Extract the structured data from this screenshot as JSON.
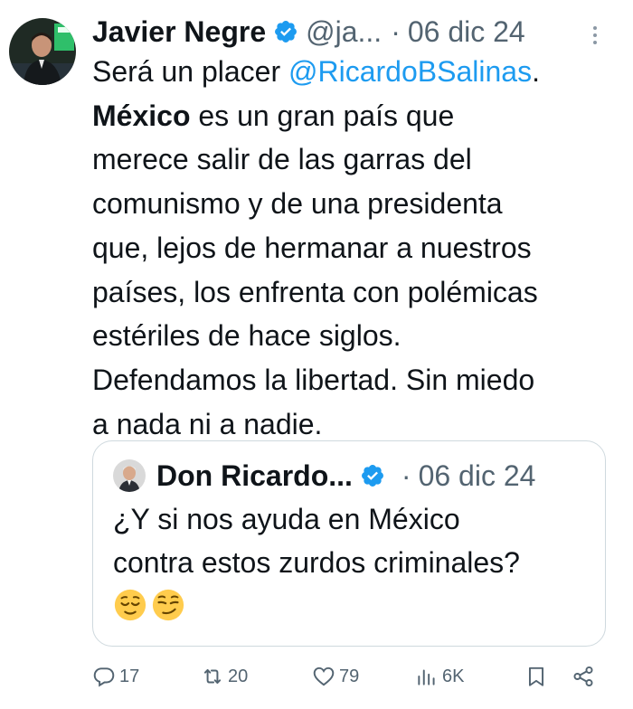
{
  "tweet": {
    "author_name": "Javier Negre",
    "handle": "@ja...",
    "separator": "·",
    "date": "06 dic 24",
    "text": {
      "line1_prefix": "Será un placer ",
      "line1_mention": "@RicardoBSalinas",
      "line1_suffix": ".",
      "line2_bold": "México",
      "line2_rest": " es un gran país que",
      "line3": "merece salir de las garras del",
      "line4": "comunismo y de una presidenta",
      "line5": "que, lejos de hermanar a nuestros",
      "line6": "países, los enfrenta con polémicas",
      "line7": "estériles de hace siglos.",
      "line8": "Defendamos la libertad. Sin miedo",
      "line9": "a nada ni a nadie."
    }
  },
  "quoted_tweet": {
    "author_name": "Don Ricardo...",
    "separator": "·",
    "date": "06 dic 24",
    "line1": "¿Y si nos ayuda en México",
    "line2": "contra estos zurdos criminales?",
    "emojis": [
      "relieved-face",
      "smirking-face"
    ]
  },
  "actions": {
    "reply_count": "17",
    "retweet_count": "20",
    "like_count": "79",
    "views_count": "6K"
  },
  "colors": {
    "accent": "#1d9bf0",
    "verified": "#1d9bf0",
    "muted": "#536471"
  }
}
